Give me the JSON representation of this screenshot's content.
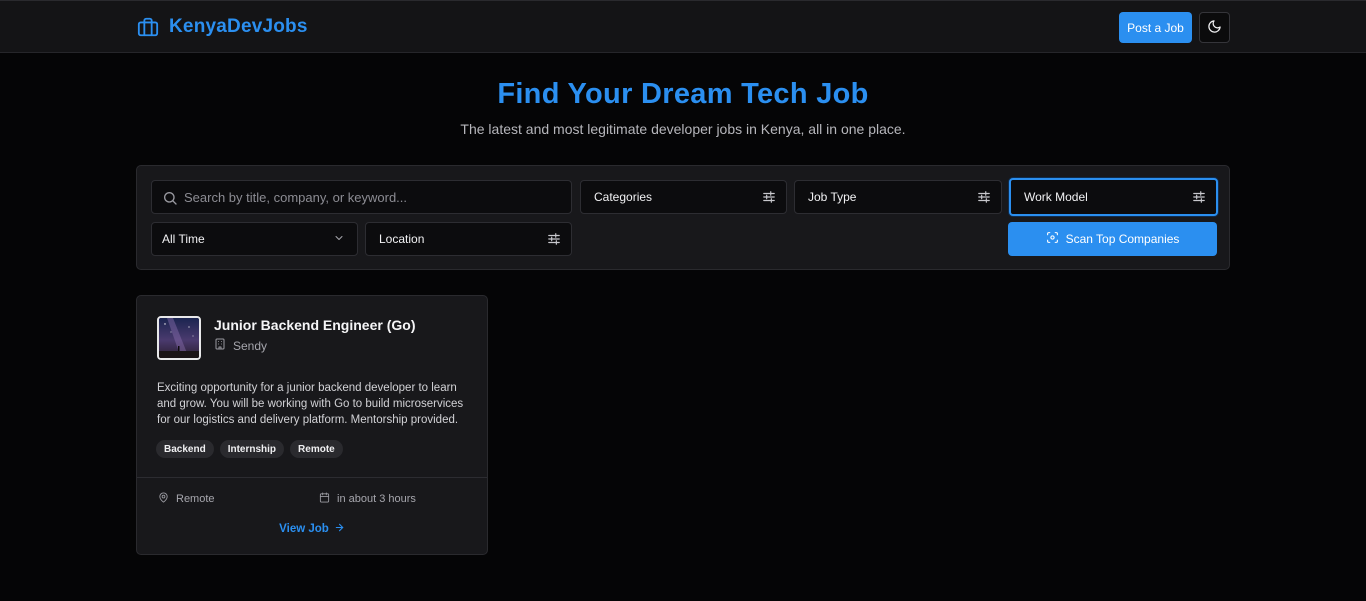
{
  "header": {
    "brand_name": "KenyaDevJobs",
    "post_job_label": "Post a Job",
    "brand_color": "#2b8ff0",
    "brand_icon": "briefcase-icon",
    "theme_icon": "moon-icon"
  },
  "hero": {
    "title": "Find Your Dream Tech Job",
    "subtitle": "The latest and most legitimate developer jobs in Kenya, all in one place."
  },
  "filters": {
    "search_placeholder": "Search by title, company, or keyword...",
    "categories_label": "Categories",
    "job_type_label": "Job Type",
    "work_model_value": "Work Model",
    "date_value": "All Time",
    "location_label": "Location",
    "scan_button_label": "Scan Top Companies"
  },
  "jobs": [
    {
      "title": "Junior Backend Engineer (Go)",
      "company": "Sendy",
      "description": "Exciting opportunity for a junior backend developer to learn and grow. You will be working with Go to build microservices for our logistics and delivery platform. Mentorship provided.",
      "tags": [
        "Backend",
        "Internship",
        "Remote"
      ],
      "location": "Remote",
      "posted": "in about 3 hours",
      "view_label": "View Job"
    }
  ]
}
